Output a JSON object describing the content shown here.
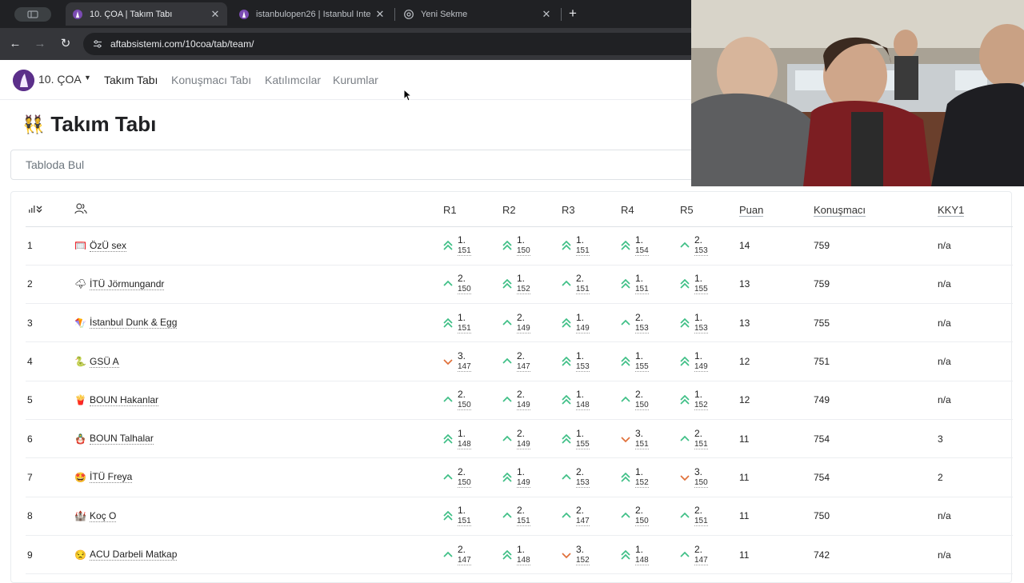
{
  "browser": {
    "tabs": [
      {
        "title": "10. ÇOA | Takım Tabı",
        "active": true
      },
      {
        "title": "istanbulopen26 | Istanbul Inte",
        "active": false
      },
      {
        "title": "Yeni Sekme",
        "active": false
      }
    ],
    "url": "aftabsistemi.com/10coa/tab/team/"
  },
  "nav": {
    "brand": "10. ÇOA",
    "links": [
      "Takım Tabı",
      "Konuşmacı Tabı",
      "Katılımcılar",
      "Kurumlar"
    ]
  },
  "page": {
    "title_emoji": "👯",
    "title": "Takım Tabı",
    "search_placeholder": "Tabloda Bul"
  },
  "table": {
    "headers": [
      "R1",
      "R2",
      "R3",
      "R4",
      "R5",
      "Puan",
      "Konuşmacı",
      "KKY1"
    ],
    "rows": [
      {
        "rank": "1",
        "emoji": "🥅",
        "team": "ÖzÜ sex",
        "rounds": [
          {
            "arrow": "up2",
            "pos": "1.",
            "pts": "151"
          },
          {
            "arrow": "up2",
            "pos": "1.",
            "pts": "150"
          },
          {
            "arrow": "up2",
            "pos": "1.",
            "pts": "151"
          },
          {
            "arrow": "up2",
            "pos": "1.",
            "pts": "154"
          },
          {
            "arrow": "up",
            "pos": "2.",
            "pts": "153"
          }
        ],
        "puan": "14",
        "konusmaci": "759",
        "kky1": "n/a"
      },
      {
        "rank": "2",
        "emoji": "🌩",
        "team": "İTÜ Jörmungandr",
        "rounds": [
          {
            "arrow": "up",
            "pos": "2.",
            "pts": "150"
          },
          {
            "arrow": "up2",
            "pos": "1.",
            "pts": "152"
          },
          {
            "arrow": "up",
            "pos": "2.",
            "pts": "151"
          },
          {
            "arrow": "up2",
            "pos": "1.",
            "pts": "151"
          },
          {
            "arrow": "up2",
            "pos": "1.",
            "pts": "155"
          }
        ],
        "puan": "13",
        "konusmaci": "759",
        "kky1": "n/a"
      },
      {
        "rank": "3",
        "emoji": "🪁",
        "team": "İstanbul Dunk & Egg",
        "rounds": [
          {
            "arrow": "up2",
            "pos": "1.",
            "pts": "151"
          },
          {
            "arrow": "up",
            "pos": "2.",
            "pts": "149"
          },
          {
            "arrow": "up2",
            "pos": "1.",
            "pts": "149"
          },
          {
            "arrow": "up",
            "pos": "2.",
            "pts": "153"
          },
          {
            "arrow": "up2",
            "pos": "1.",
            "pts": "153"
          }
        ],
        "puan": "13",
        "konusmaci": "755",
        "kky1": "n/a"
      },
      {
        "rank": "4",
        "emoji": "🐍",
        "team": "GSÜ A",
        "rounds": [
          {
            "arrow": "down",
            "pos": "3.",
            "pts": "147"
          },
          {
            "arrow": "up",
            "pos": "2.",
            "pts": "147"
          },
          {
            "arrow": "up2",
            "pos": "1.",
            "pts": "153"
          },
          {
            "arrow": "up2",
            "pos": "1.",
            "pts": "155"
          },
          {
            "arrow": "up2",
            "pos": "1.",
            "pts": "149"
          }
        ],
        "puan": "12",
        "konusmaci": "751",
        "kky1": "n/a"
      },
      {
        "rank": "5",
        "emoji": "🍟",
        "team": "BOUN Hakanlar",
        "rounds": [
          {
            "arrow": "up",
            "pos": "2.",
            "pts": "150"
          },
          {
            "arrow": "up",
            "pos": "2.",
            "pts": "149"
          },
          {
            "arrow": "up2",
            "pos": "1.",
            "pts": "148"
          },
          {
            "arrow": "up",
            "pos": "2.",
            "pts": "150"
          },
          {
            "arrow": "up2",
            "pos": "1.",
            "pts": "152"
          }
        ],
        "puan": "12",
        "konusmaci": "749",
        "kky1": "n/a"
      },
      {
        "rank": "6",
        "emoji": "🪆",
        "team": "BOUN Talhalar",
        "rounds": [
          {
            "arrow": "up2",
            "pos": "1.",
            "pts": "148"
          },
          {
            "arrow": "up",
            "pos": "2.",
            "pts": "149"
          },
          {
            "arrow": "up2",
            "pos": "1.",
            "pts": "155"
          },
          {
            "arrow": "down",
            "pos": "3.",
            "pts": "151"
          },
          {
            "arrow": "up",
            "pos": "2.",
            "pts": "151"
          }
        ],
        "puan": "11",
        "konusmaci": "754",
        "kky1": "3"
      },
      {
        "rank": "7",
        "emoji": "🤩",
        "team": "İTÜ Freya",
        "rounds": [
          {
            "arrow": "up",
            "pos": "2.",
            "pts": "150"
          },
          {
            "arrow": "up2",
            "pos": "1.",
            "pts": "149"
          },
          {
            "arrow": "up",
            "pos": "2.",
            "pts": "153"
          },
          {
            "arrow": "up2",
            "pos": "1.",
            "pts": "152"
          },
          {
            "arrow": "down",
            "pos": "3.",
            "pts": "150"
          }
        ],
        "puan": "11",
        "konusmaci": "754",
        "kky1": "2"
      },
      {
        "rank": "8",
        "emoji": "🏰",
        "team": "Koç O",
        "rounds": [
          {
            "arrow": "up2",
            "pos": "1.",
            "pts": "151"
          },
          {
            "arrow": "up",
            "pos": "2.",
            "pts": "151"
          },
          {
            "arrow": "up",
            "pos": "2.",
            "pts": "147"
          },
          {
            "arrow": "up",
            "pos": "2.",
            "pts": "150"
          },
          {
            "arrow": "up",
            "pos": "2.",
            "pts": "151"
          }
        ],
        "puan": "11",
        "konusmaci": "750",
        "kky1": "n/a"
      },
      {
        "rank": "9",
        "emoji": "😒",
        "team": "ACU Darbeli Matkap",
        "rounds": [
          {
            "arrow": "up",
            "pos": "2.",
            "pts": "147"
          },
          {
            "arrow": "up2",
            "pos": "1.",
            "pts": "148"
          },
          {
            "arrow": "down",
            "pos": "3.",
            "pts": "152"
          },
          {
            "arrow": "up2",
            "pos": "1.",
            "pts": "148"
          },
          {
            "arrow": "up",
            "pos": "2.",
            "pts": "147"
          }
        ],
        "puan": "11",
        "konusmaci": "742",
        "kky1": "n/a"
      }
    ]
  },
  "colors": {
    "up": "#3fbf86",
    "down": "#e0703a",
    "brand": "#5b2f8a"
  }
}
